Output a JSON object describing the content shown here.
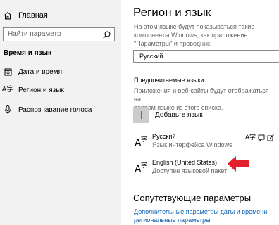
{
  "sidebar": {
    "home_label": "Главная",
    "search_placeholder": "Найти параметр",
    "section_heading": "Время и язык",
    "items": [
      {
        "label": "Дата и время",
        "icon": "calendar-icon"
      },
      {
        "label": "Регион и язык",
        "icon": "language-icon"
      },
      {
        "label": "Распознавание голоса",
        "icon": "microphone-icon"
      }
    ]
  },
  "main": {
    "title": "Регион и язык",
    "description_lines": [
      "На этом языке будут показываться такие",
      "компоненты Windows, как приложение",
      "\"Параметры\" и проводник."
    ],
    "region_value": "Русский",
    "preferred_heading": "Предпочитаемые языки",
    "preferred_description_lines": [
      "Приложения и веб-сайты будут отображаться на",
      "первом языке из этого списка."
    ],
    "add_language_label": "Добавьте язык",
    "languages": [
      {
        "name": "Русский",
        "subtitle": "Язык интерфейса Windows",
        "badges": [
          "language-badge-icon",
          "speech-badge-icon",
          "handwriting-badge-icon"
        ]
      },
      {
        "name": "English (United States)",
        "subtitle": "Доступен языковой пакет"
      }
    ],
    "related_heading": "Сопутствующие параметры",
    "related_links": [
      "Дополнительные параметры даты и времени,",
      "региональные параметры"
    ]
  },
  "colors": {
    "sidebar_bg": "#f2f2f2",
    "link": "#0a5fb4",
    "annotation_arrow": "#e0202a",
    "add_button_bg": "#cccccc"
  }
}
